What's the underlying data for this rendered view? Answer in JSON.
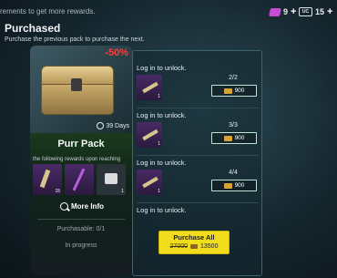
{
  "header": {
    "hint": "rements to get more rewards.",
    "currencies": [
      {
        "icon": "ticket-icon",
        "value": "9"
      },
      {
        "icon": "uc-icon",
        "icon_label": "UC",
        "value": "15"
      }
    ]
  },
  "section": {
    "title": "Purchased",
    "subtitle": "Purchase the previous pack to purchase the next."
  },
  "pack": {
    "discount": "-50%",
    "days": "39 Days",
    "name": "Purr Pack",
    "hint": "the following rewards upon reaching",
    "rewards": [
      {
        "icon": "key-icon",
        "qty": "15"
      },
      {
        "icon": "spear-icon",
        "qty": ""
      },
      {
        "icon": "box-icon",
        "qty": "1"
      }
    ],
    "more_info": "More Info",
    "purchasable": "Purchasable: 0/1",
    "status": "In progress"
  },
  "rows": [
    {
      "title": "Log in to unlock.",
      "qty": "1",
      "count": "2/2",
      "price": "900"
    },
    {
      "title": "Log in to unlock.",
      "qty": "1",
      "count": "3/3",
      "price": "900"
    },
    {
      "title": "Log in to unlock.",
      "qty": "1",
      "count": "4/4",
      "price": "900"
    },
    {
      "title": "Log in to unlock.",
      "qty": "",
      "count": "",
      "price": ""
    }
  ],
  "buy_all": {
    "label": "Purchase All",
    "old_price": "27000",
    "new_price": "13500"
  },
  "colors": {
    "accent": "#f2dd1c",
    "discount": "#ff3b3b"
  }
}
